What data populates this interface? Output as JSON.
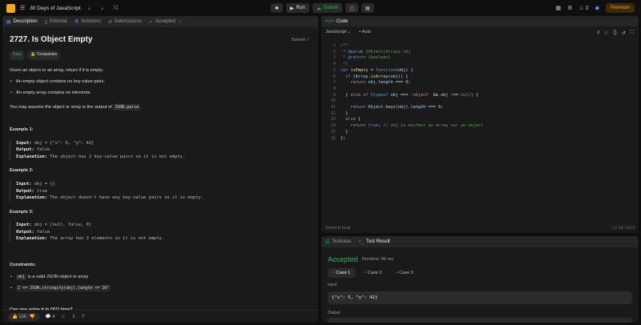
{
  "topbar": {
    "title": "30 Days of JavaScript",
    "run": "Run",
    "submit": "Submit",
    "fire_count": "0",
    "premium": "Premium"
  },
  "tabs": [
    {
      "label": "Description"
    },
    {
      "label": "Editorial"
    },
    {
      "label": "Solutions"
    },
    {
      "label": "Submissions"
    },
    {
      "label": "Accepted"
    }
  ],
  "problem": {
    "title": "2727. Is Object Empty",
    "solved": "Solved",
    "difficulty": "Easy",
    "companies": "Companies",
    "intro": "Given an object or an array, return if it is empty.",
    "bullet1": "An empty object contains no key-value pairs.",
    "bullet2": "An empty array contains no elements.",
    "assume_pre": "You may assume the object or array is the output of",
    "assume_code": "JSON.parse",
    "assume_post": ".",
    "examples": [
      {
        "heading": "Example 1:",
        "input": "obj = {\"x\": 5, \"y\": 42}",
        "output": "false",
        "explanation": "The object has 2 key-value pairs so it is not empty."
      },
      {
        "heading": "Example 2:",
        "input": "obj = {}",
        "output": "true",
        "explanation": "The object doesn't have any key-value pairs so it is empty."
      },
      {
        "heading": "Example 3:",
        "input": "obj = [null, false, 0]",
        "output": "false",
        "explanation": "The array has 3 elements so it is not empty."
      }
    ],
    "input_label": "Input:",
    "output_label": "Output:",
    "explanation_label": "Explanation:",
    "constraints_heading": "Constraints:",
    "constraint1_code": "obj",
    "constraint1_text": "is a valid JSON object or array",
    "constraint2_code": "2 <= JSON.stringify(obj).length <= 10⁵",
    "followup": "Can you solve it in O(1) time?"
  },
  "footer": {
    "likes": "136",
    "comments": "4"
  },
  "code": {
    "header": "Code",
    "language": "JavaScript",
    "mode": "Auto",
    "line_numbers": [
      "1",
      "2",
      "3",
      "4",
      "5",
      "6",
      "7",
      "8",
      "9",
      "10",
      "11",
      "12",
      "13",
      "14",
      "15",
      "16"
    ],
    "saved": "Saved to local",
    "cursor": "Ln 14, Col 3"
  },
  "test": {
    "tab_testcase": "Testcase",
    "tab_result": "Test Result",
    "status": "Accepted",
    "runtime": "Runtime: 86 ms",
    "cases": [
      "Case 1",
      "Case 2",
      "Case 3"
    ],
    "input_label": "Input",
    "input_value": "{\"x\": 5, \"y\": 42}",
    "output_label": "Output"
  },
  "colors": {
    "accent_green": "#2db55d",
    "premium": "#ffa116",
    "easy": "#2cbb5d"
  }
}
